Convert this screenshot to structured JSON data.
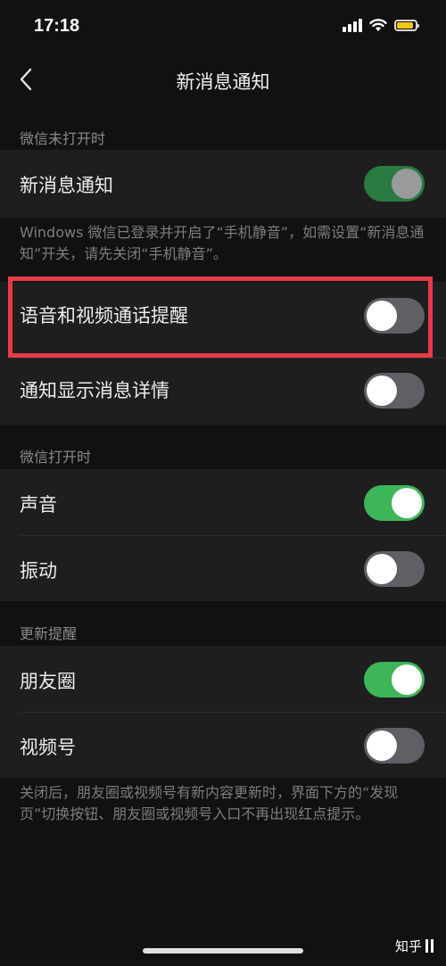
{
  "status_bar": {
    "time": "17:18",
    "battery_color": "#f5c518",
    "icons": [
      "signal-icon",
      "wifi-icon",
      "battery-icon"
    ]
  },
  "nav": {
    "title": "新消息通知",
    "back_icon": "chevron-left-icon"
  },
  "sections": [
    {
      "header": "微信未打开时"
    },
    {
      "header": "微信打开时"
    },
    {
      "header": "更新提醒"
    }
  ],
  "rows": {
    "new_message": {
      "label": "新消息通知",
      "state": "on-disabled"
    },
    "voice_video": {
      "label": "语音和视频通话提醒",
      "state": "off"
    },
    "show_details": {
      "label": "通知显示消息详情",
      "state": "off"
    },
    "sound": {
      "label": "声音",
      "state": "on"
    },
    "vibrate": {
      "label": "振动",
      "state": "off"
    },
    "moments": {
      "label": "朋友圈",
      "state": "on"
    },
    "channels": {
      "label": "视频号",
      "state": "off"
    }
  },
  "notes": {
    "windows_note": "Windows 微信已登录并开启了“手机静音”，如需设置“新消息通知”开关，请先关闭“手机静音”。",
    "update_note": "关闭后，朋友圈或视频号有新内容更新时，界面下方的“发现页”切换按钮、朋友圈或视频号入口不再出现红点提示。"
  },
  "colors": {
    "toggle_on": "#3fb55a",
    "toggle_off": "#5f5f66",
    "highlight": "#e53c48",
    "background": "#111111",
    "row_bg": "#1e1e1e"
  },
  "watermark": {
    "text": "知乎"
  }
}
